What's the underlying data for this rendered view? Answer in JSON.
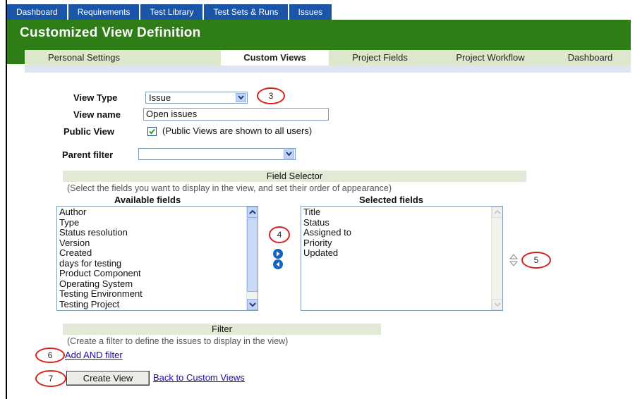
{
  "top_tabs": [
    "Dashboard",
    "Requirements",
    "Test Library",
    "Test Sets & Runs",
    "Issues"
  ],
  "page_title": "Customized View Definition",
  "sub_tabs": [
    "Personal Settings",
    "Custom Views",
    "Project Fields",
    "Project Workflow",
    "Dashboard"
  ],
  "active_sub_tab": "Custom Views",
  "form": {
    "view_type_label": "View Type",
    "view_type_value": "Issue",
    "view_name_label": "View name",
    "view_name_value": "Open issues",
    "public_view_label": "Public View",
    "public_view_checked": true,
    "public_view_note": "(Public Views are shown to all users)",
    "parent_filter_label": "Parent filter",
    "parent_filter_value": ""
  },
  "field_selector": {
    "title": "Field Selector",
    "hint": "(Select the fields you want to display in the view, and set their order of appearance)",
    "available_label": "Available fields",
    "selected_label": "Selected fields",
    "available_fields": [
      "Author",
      "Type",
      "Status resolution",
      "Version",
      "Created",
      "days for testing",
      "Product Component",
      "Operating System",
      "Testing Environment",
      "Testing Project"
    ],
    "selected_fields": [
      "Title",
      "Status",
      "Assigned to",
      "Priority",
      "Updated"
    ]
  },
  "filter": {
    "title": "Filter",
    "hint": "(Create a filter to define the issues to display in the view)",
    "add_and_filter": "Add AND filter"
  },
  "actions": {
    "create_view": "Create View",
    "back_link": "Back to Custom Views"
  },
  "callouts": [
    "3",
    "4",
    "5",
    "6",
    "7"
  ],
  "colors": {
    "top_tab_bg": "#1a55a8",
    "header_green": "#2e7d16",
    "subtab_bg": "#dde7cc",
    "section_bg": "#e2ead6",
    "callout_red": "#d8201f",
    "link_blue": "#1a0dab"
  }
}
